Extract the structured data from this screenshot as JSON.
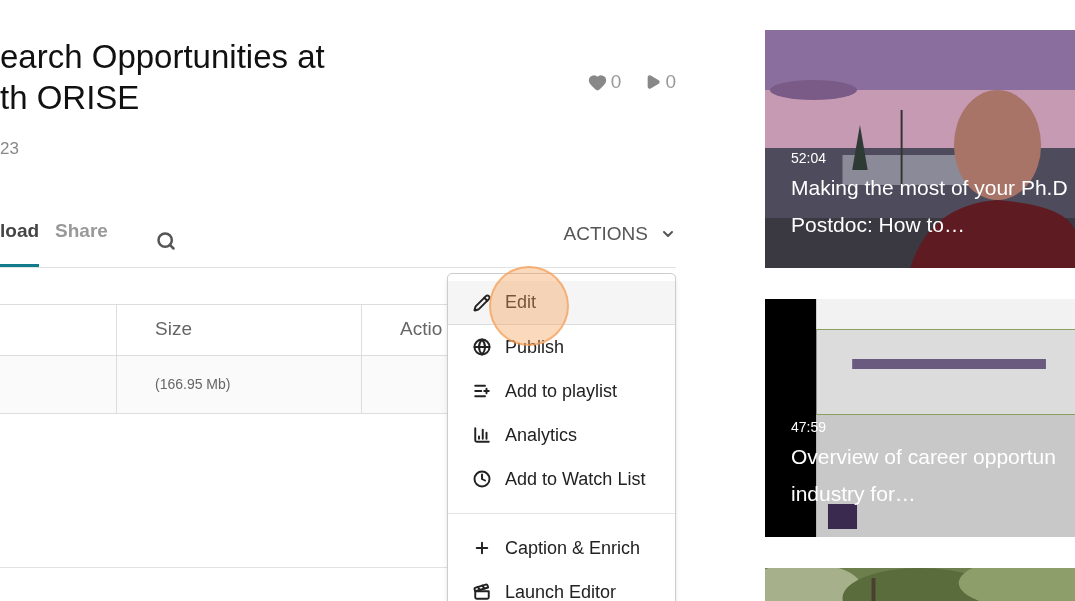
{
  "title_lines": [
    "earch Opportunities at",
    "th ORISE"
  ],
  "date": "23",
  "stats": [
    {
      "kind": "likes",
      "count": "0"
    },
    {
      "kind": "plays",
      "count": "0"
    }
  ],
  "tabs": [
    {
      "label": "load",
      "selected": true
    },
    {
      "label": "Share",
      "selected": false
    }
  ],
  "actions_label": "ACTIONS",
  "table": {
    "columns": [
      "Size",
      "Actio"
    ],
    "rows": [
      {
        "size": "(166.95 Mb)"
      }
    ]
  },
  "menu": {
    "items": [
      {
        "kind": "edit",
        "label": "Edit",
        "selected": true
      },
      {
        "kind": "publish",
        "label": "Publish",
        "selected": false
      },
      {
        "kind": "playlist",
        "label": "Add to playlist",
        "selected": false
      },
      {
        "kind": "analytics",
        "label": "Analytics",
        "selected": false
      },
      {
        "kind": "watch",
        "label": "Add to Watch List",
        "selected": false
      },
      {
        "kind": "divider"
      },
      {
        "kind": "caption",
        "label": "Caption & Enrich",
        "selected": false
      },
      {
        "kind": "editor",
        "label": "Launch Editor",
        "selected": false
      }
    ]
  },
  "related": [
    {
      "kind": "campus",
      "duration": "52:04",
      "title_lines": [
        "Making the most of your Ph.D",
        "Postdoc: How to…"
      ]
    },
    {
      "kind": "slide",
      "duration": "47:59",
      "title_lines": [
        "Overview of career opportun",
        "industry for…"
      ]
    },
    {
      "kind": "trees"
    }
  ]
}
